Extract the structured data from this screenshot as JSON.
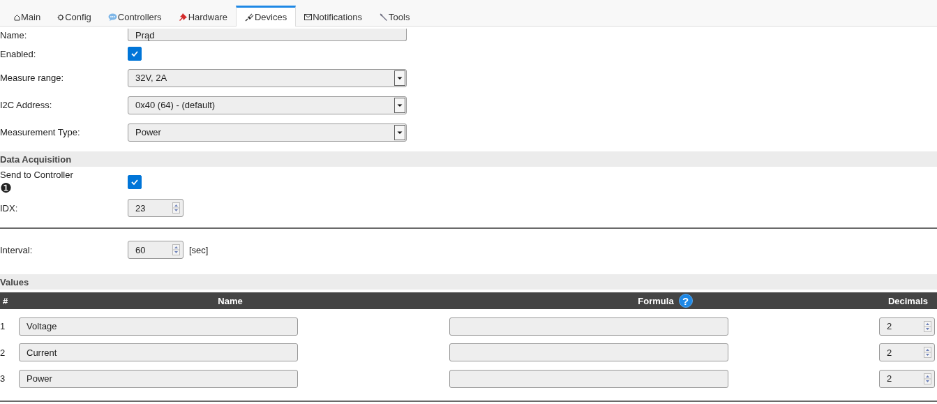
{
  "tabs": [
    {
      "label": "Main",
      "selected": false
    },
    {
      "label": "Config",
      "selected": false
    },
    {
      "label": "Controllers",
      "selected": false
    },
    {
      "label": "Hardware",
      "selected": false
    },
    {
      "label": "Devices",
      "selected": true
    },
    {
      "label": "Notifications",
      "selected": false
    },
    {
      "label": "Tools",
      "selected": false
    }
  ],
  "device_fields": [
    {
      "kind": "text",
      "label": "Name:",
      "value": "Prąd"
    },
    {
      "kind": "checkbox",
      "label": "Enabled:",
      "checked": true
    },
    {
      "kind": "select",
      "label": "Measure range:",
      "value": "32V, 2A"
    },
    {
      "kind": "select",
      "label": "I2C Address:",
      "value": "0x40 (64) - (default)"
    },
    {
      "kind": "select",
      "label": "Measurement Type:",
      "value": "Power"
    }
  ],
  "data_acquisition": {
    "title": "Data Acquisition",
    "fields": [
      {
        "kind": "checkbox",
        "label": "Send to Controller",
        "note": "❶",
        "checked": true
      },
      {
        "kind": "number",
        "label": "IDX:",
        "value": "23"
      }
    ]
  },
  "interval": {
    "label": "Interval:",
    "value": "60",
    "unit": "[sec]"
  },
  "values": {
    "title": "Values",
    "columns": [
      {
        "label": "#"
      },
      {
        "label": "Name"
      },
      {
        "label": "Formula",
        "help": "?"
      },
      {
        "label": "Decimals"
      }
    ],
    "rows": [
      {
        "index": "1",
        "name": "Voltage",
        "decimals": "2"
      },
      {
        "index": "2",
        "name": "Current",
        "decimals": "2"
      },
      {
        "index": "3",
        "name": "Power",
        "decimals": "2"
      }
    ]
  }
}
